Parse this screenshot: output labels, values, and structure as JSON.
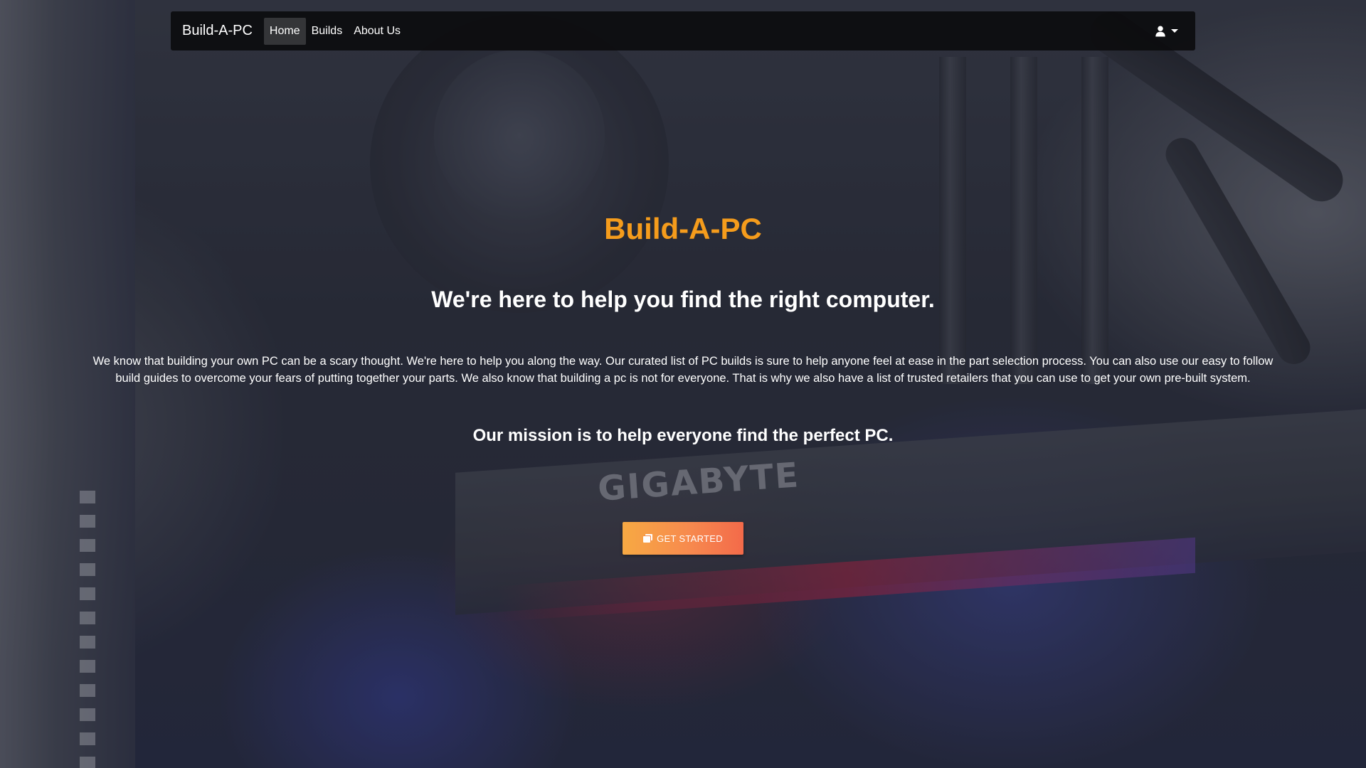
{
  "navbar": {
    "brand": "Build-A-PC",
    "links": [
      {
        "label": "Home",
        "active": true
      },
      {
        "label": "Builds",
        "active": false
      },
      {
        "label": "About Us",
        "active": false
      }
    ],
    "user_menu_icon": "user-icon",
    "user_menu_caret": "caret-down-icon"
  },
  "hero": {
    "title": "Build-A-PC",
    "subtitle": "We're here to help you find the right computer.",
    "body": "We know that building your own PC can be a scary thought. We're here to help you along the way. Our curated list of PC builds is sure to help anyone feel at ease in the part selection process. You can also use our easy to follow build guides to overcome your fears of putting together your parts. We also know that building a pc is not for everyone. That is why we also have a list of trusted retailers that you can use to get your own pre-built system.",
    "mission": "Our mission is to help everyone find the perfect PC.",
    "cta_label": "GET STARTED",
    "cta_icon": "clone-icon"
  },
  "background": {
    "description_visible_text": "GIGABYTE"
  },
  "colors": {
    "accent": "#f59c1c",
    "cta_gradient_start": "#f7a943",
    "cta_gradient_end": "#f36a4a",
    "navbar_bg": "#0c0c0e"
  }
}
